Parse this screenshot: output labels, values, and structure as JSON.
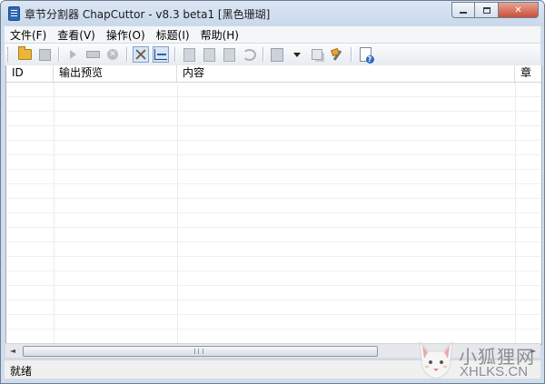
{
  "window": {
    "title": "章节分割器 ChapCuttor - v8.3 beta1 [黑色珊瑚]",
    "minimize_label": "",
    "close_label": "✕"
  },
  "menu": [
    {
      "label": "文件(F)"
    },
    {
      "label": "查看(V)"
    },
    {
      "label": "操作(O)"
    },
    {
      "label": "标题(I)"
    },
    {
      "label": "帮助(H)"
    }
  ],
  "toolbar": {
    "stop_glyph": "✕",
    "icons": [
      "folder-open-icon",
      "save-icon",
      "play-icon",
      "ruler-icon",
      "stop-icon",
      "tools-icon",
      "chart-icon",
      "doc-icon",
      "doc-icon",
      "doc-icon",
      "undo-icon",
      "edit-icon",
      "dropdown-arrow-icon",
      "copy-icon",
      "wrench-icon",
      "help-icon"
    ]
  },
  "list": {
    "columns": [
      {
        "label": "ID"
      },
      {
        "label": "输出预览"
      },
      {
        "label": "内容"
      },
      {
        "label": "章"
      }
    ],
    "rows": []
  },
  "scrollbar": {
    "left_arrow": "◄",
    "right_arrow": "►"
  },
  "status": {
    "text": "就绪"
  },
  "watermark": {
    "text_cn": "小狐狸网",
    "text_en": "XHLKS.CN"
  }
}
